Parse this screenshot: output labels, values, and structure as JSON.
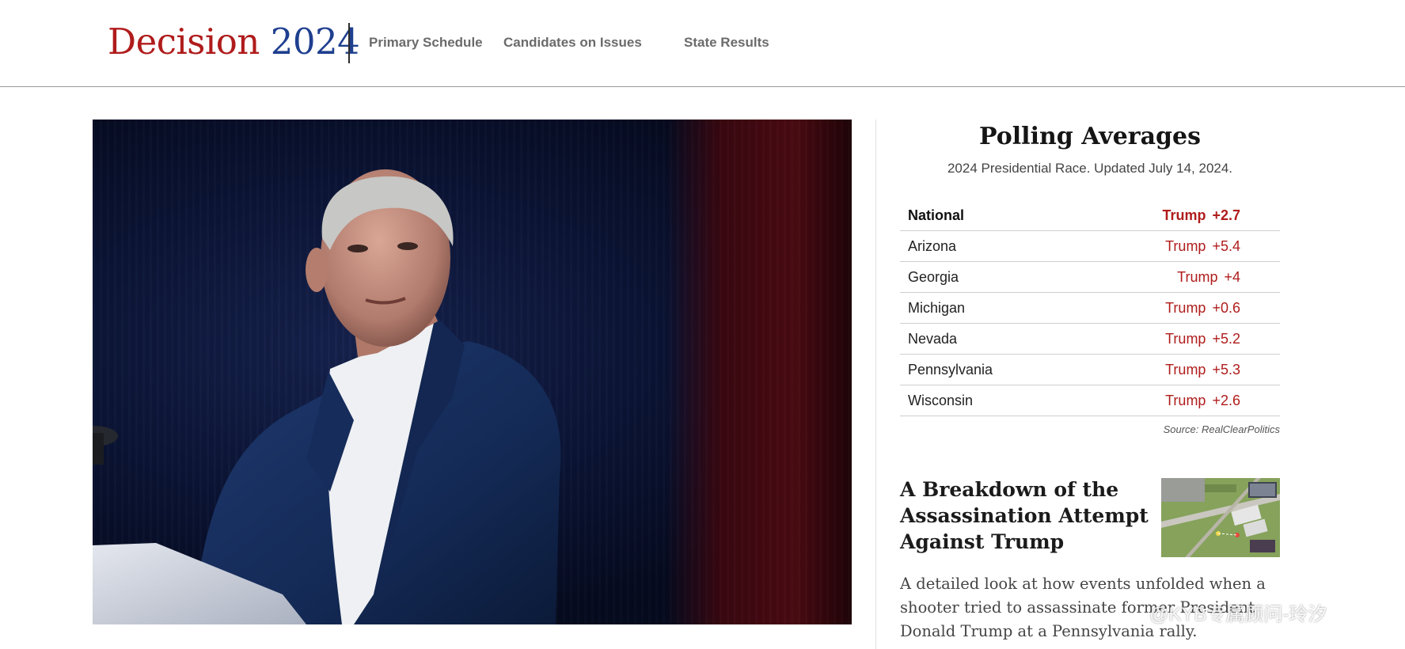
{
  "header": {
    "brand_word": "Decision",
    "brand_year": "2024",
    "nav": [
      {
        "label": "Primary Schedule"
      },
      {
        "label": "Candidates on Issues"
      },
      {
        "label": "State Results"
      }
    ]
  },
  "hero": {
    "image_icon": "speaker-at-podium-photo"
  },
  "polling": {
    "title": "Polling Averages",
    "subtitle": "2024 Presidential Race. Updated July 14, 2024.",
    "rows": [
      {
        "state": "National",
        "candidate": "Trump",
        "margin": "+2.7"
      },
      {
        "state": "Arizona",
        "candidate": "Trump",
        "margin": "+5.4"
      },
      {
        "state": "Georgia",
        "candidate": "Trump",
        "margin": "+4"
      },
      {
        "state": "Michigan",
        "candidate": "Trump",
        "margin": "+0.6"
      },
      {
        "state": "Nevada",
        "candidate": "Trump",
        "margin": "+5.2"
      },
      {
        "state": "Pennsylvania",
        "candidate": "Trump",
        "margin": "+5.3"
      },
      {
        "state": "Wisconsin",
        "candidate": "Trump",
        "margin": "+2.6"
      }
    ],
    "source": "Source: RealClearPolitics"
  },
  "story": {
    "title": "A Breakdown of the Assassination Attempt Against Trump",
    "summary": "A detailed look at how events unfolded when a shooter tried to assassinate former President Donald Trump at a Pennsylvania rally.",
    "thumbnail_icon": "aerial-map-thumbnail"
  },
  "watermark": "@KYB专属顾问-玲汐",
  "colors": {
    "brand_red": "#b01c1c",
    "brand_blue": "#1f3f8f",
    "nav_gray": "#6b6b6b"
  }
}
